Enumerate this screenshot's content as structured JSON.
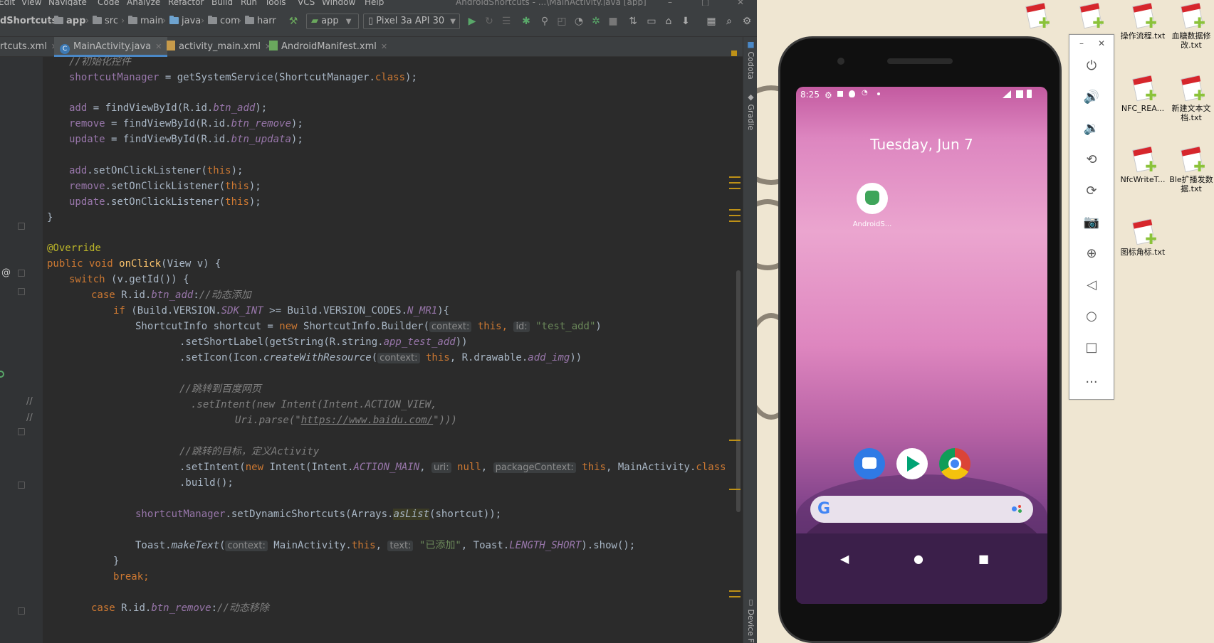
{
  "menubar": {
    "items": [
      "Edit",
      "View",
      "Navigate",
      "Code",
      "Analyze",
      "Refactor",
      "Build",
      "Run",
      "Tools",
      "VCS",
      "Window",
      "Help"
    ],
    "title": "AndroidShortcuts - ...\\MainActivity.java [app]"
  },
  "navbar": {
    "project": "dShortcuts",
    "module": "app",
    "path": [
      "src",
      "main",
      "java",
      "com",
      "harr"
    ],
    "run_config": "app",
    "device": "Pixel 3a API 30"
  },
  "tabs": [
    {
      "label": "rtcuts.xml"
    },
    {
      "label": "MainActivity.java"
    },
    {
      "label": "activity_main.xml"
    },
    {
      "label": "AndroidManifest.xml"
    }
  ],
  "side_tools": {
    "codota": "Codota",
    "gradle": "Gradle",
    "device": "Device F"
  },
  "code": {
    "l1": "//初始化控件",
    "l2a": "shortcutManager",
    "l2b": " = getSystemService(ShortcutManager.",
    "l2c": "class",
    "l2d": ");",
    "l4a": "add",
    "l4b": " = findViewById(R.id.",
    "l4c": "btn_add",
    "l4d": ");",
    "l5a": "remove",
    "l5b": " = findViewById(R.id.",
    "l5c": "btn_remove",
    "l5d": ");",
    "l6a": "update",
    "l6b": " = findViewById(R.id.",
    "l6c": "btn_updata",
    "l6d": ");",
    "l8a": "add",
    "l8b": ".setOnClickListener(",
    "l8c": "this",
    "l8d": ");",
    "l9a": "remove",
    "l9b": ".setOnClickListener(",
    "l9c": "this",
    "l9d": ");",
    "l10a": "update",
    "l10b": ".setOnClickListener(",
    "l10c": "this",
    "l10d": ");",
    "l11": "}",
    "l13": "@Override",
    "l14a": "public void ",
    "l14b": "onClick",
    "l14c": "(View v) {",
    "l15a": "switch ",
    "l15b": "(v.getId()) {",
    "l16a": "case ",
    "l16b": "R.id.",
    "l16c": "btn_add",
    "l16d": ":",
    "l16e": "//动态添加",
    "l17a": "if ",
    "l17b": "(Build.VERSION.",
    "l17c": "SDK_INT",
    "l17d": " >= Build.VERSION_CODES.",
    "l17e": "N_MR1",
    "l17f": "){",
    "l18a": "ShortcutInfo shortcut = ",
    "l18b": "new ",
    "l18c": "ShortcutInfo.Builder(",
    "l18h1": "context:",
    "l18d": "this",
    "l18e": ", ",
    "l18h2": "id:",
    "l18f": "\"test_add\"",
    "l18g": ")",
    "l19a": ".setShortLabel(getString(R.string.",
    "l19b": "app_test_add",
    "l19c": "))",
    "l20a": ".setIcon(Icon.",
    "l20b": "createWithResource",
    "l20c": "(",
    "l20h": "context:",
    "l20d": "this",
    "l20e": ", R.drawable.",
    "l20f": "add_img",
    "l20g": "))",
    "l22": "//跳转到百度网页",
    "l23a": ".setIntent(",
    "l23b": "new ",
    "l23c": "Intent(Intent.",
    "l23d": "ACTION_VIEW",
    "l23e": ",",
    "l24a": "Uri.parse(",
    "l24b": "\"",
    "l24c": "https://www.baidu.com/",
    "l24d": "\"",
    "l24e": ")))",
    "l26": "//跳转的目标，定义Activity",
    "l27a": ".setIntent(",
    "l27b": "new ",
    "l27c": "Intent(Intent.",
    "l27d": "ACTION_MAIN",
    "l27e": ", ",
    "l27h1": "uri:",
    "l27f": "null",
    "l27g": ", ",
    "l27h2": "packageContext:",
    "l27i": "this",
    "l27j": ", MainActivity.",
    "l27k": "class",
    "l27l": "))",
    "l28": ".build();",
    "l30a": "shortcutManager",
    "l30b": ".setDynamicShortcuts(Arrays.",
    "l30c": "asList",
    "l30d": "(shortcut));",
    "l32a": "Toast.",
    "l32b": "makeText",
    "l32c": "(",
    "l32h1": "context:",
    "l32d": "MainActivity.",
    "l32e": "this",
    "l32f": ", ",
    "l32h2": "text:",
    "l32g": "\"已添加\"",
    "l32i": ", Toast.",
    "l32j": "LENGTH_SHORT",
    "l32k": ").show();",
    "l33": "}",
    "l34": "break;",
    "l36a": "case ",
    "l36b": "R.id.",
    "l36c": "btn_remove",
    "l36d": ":",
    "l36e": "//动态移除"
  },
  "gutter": {
    "at": "@",
    "slash1": "//",
    "slash2": "//"
  },
  "phone": {
    "time": "8:25",
    "date": "Tuesday, Jun 7",
    "app_label": "AndroidS...",
    "search_logo": "G"
  },
  "emulator_panel": {
    "minimize": "–",
    "close": "✕",
    "more": "..."
  },
  "desktop_icons": [
    {
      "label": ""
    },
    {
      "label": ""
    },
    {
      "label": ""
    },
    {
      "label": "操作流程.txt"
    },
    {
      "label": "血糖数据修改.txt"
    },
    {
      "label": "NFC_REA..."
    },
    {
      "label": "新建文本文档.txt"
    },
    {
      "label": "NfcWriteT..."
    },
    {
      "label": "Ble扩播发数据.txt"
    },
    {
      "label": "图标角标.txt"
    }
  ]
}
